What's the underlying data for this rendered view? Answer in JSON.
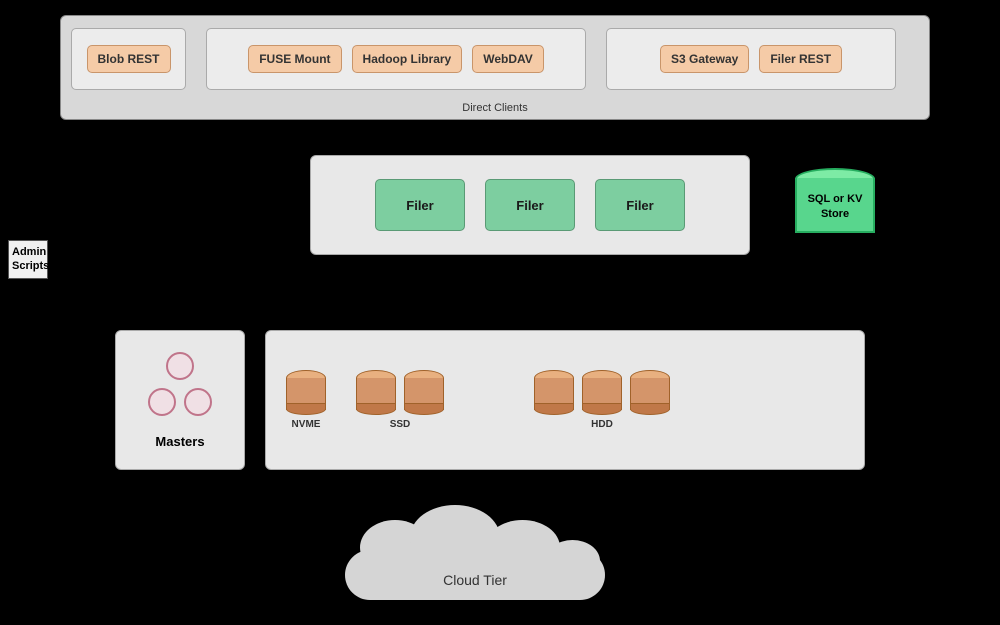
{
  "admin_scripts": {
    "label": "Admin Scripts"
  },
  "direct_clients": {
    "label": "Direct Clients",
    "groups": {
      "blob_rest": {
        "label": "Blob REST"
      },
      "fuse_mount": {
        "label": "FUSE Mount"
      },
      "hadoop_library": {
        "label": "Hadoop Library"
      },
      "webdav": {
        "label": "WebDAV"
      },
      "s3_gateway": {
        "label": "S3 Gateway"
      },
      "filer_rest": {
        "label": "Filer REST"
      }
    }
  },
  "filers": [
    {
      "label": "Filer"
    },
    {
      "label": "Filer"
    },
    {
      "label": "Filer"
    }
  ],
  "sql_kv": {
    "label": "SQL or KV\nStore"
  },
  "masters": {
    "label": "Masters"
  },
  "storage": {
    "nvme_label": "NVME",
    "ssd_label": "SSD",
    "hdd_label": "HDD"
  },
  "cloud": {
    "label": "Cloud Tier"
  }
}
